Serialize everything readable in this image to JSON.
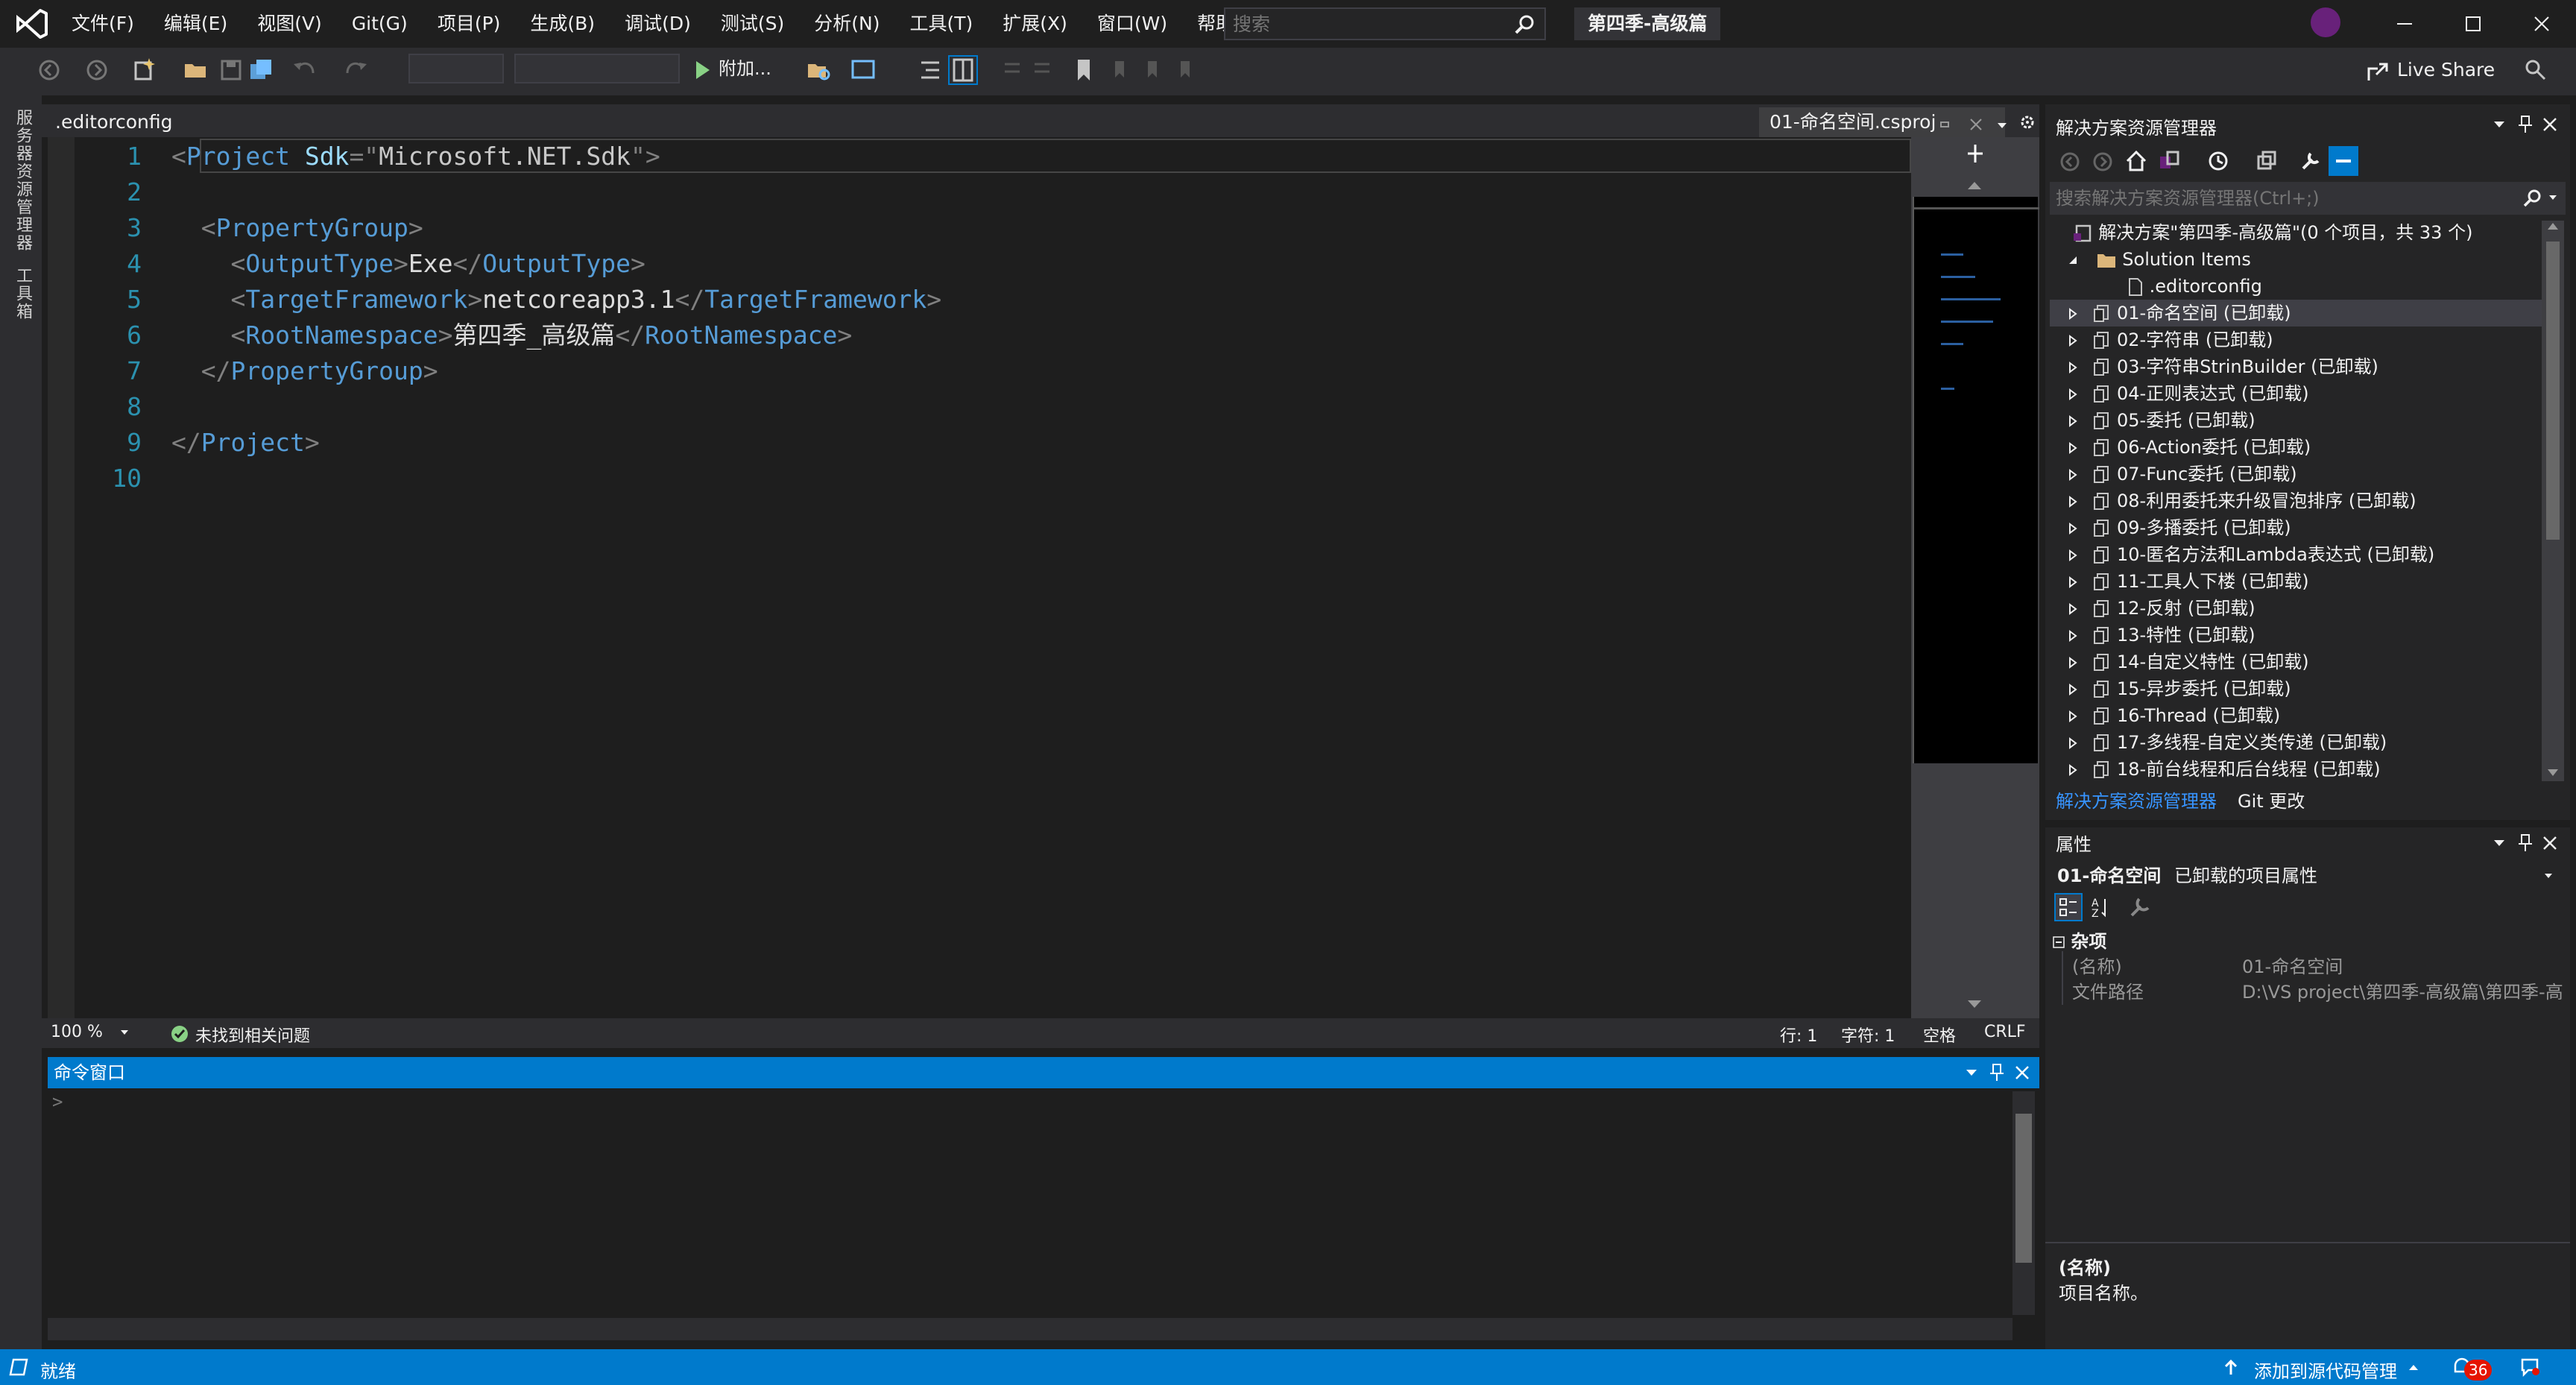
{
  "menu": [
    "文件(F)",
    "编辑(E)",
    "视图(V)",
    "Git(G)",
    "项目(P)",
    "生成(B)",
    "调试(D)",
    "测试(S)",
    "分析(N)",
    "工具(T)",
    "扩展(X)",
    "窗口(W)",
    "帮助(H)"
  ],
  "search": {
    "placeholder": "搜索"
  },
  "solution_name": "第四季-高级篇",
  "toolbar": {
    "attach_label": "附加...",
    "live_share": "Live Share"
  },
  "left_rail": {
    "server_explorer": "服务器资源管理器",
    "toolbox": "工具箱"
  },
  "editor_tabs": {
    "left_file": ".editorconfig",
    "active_file": "01-命名空间.csproj"
  },
  "code": {
    "line_numbers": [
      "1",
      "2",
      "3",
      "4",
      "5",
      "6",
      "7",
      "8",
      "9",
      "10"
    ],
    "l1": {
      "open": "<",
      "tag": "Project",
      "attr": " Sdk",
      "eq": "=\"",
      "val": "Microsoft.NET.Sdk",
      "close": "\">"
    },
    "l3": {
      "open": "<",
      "tag": "PropertyGroup",
      "close": ">"
    },
    "l4": {
      "tag": "OutputType",
      "text": "Exe"
    },
    "l5": {
      "tag": "TargetFramework",
      "text": "netcoreapp3.1"
    },
    "l6": {
      "tag": "RootNamespace",
      "text": "第四季_高级篇"
    },
    "l7": {
      "tag": "PropertyGroup"
    },
    "l9": {
      "tag": "Project"
    }
  },
  "editor_status": {
    "zoom": "100 %",
    "issues": "未找到相关问题",
    "line": "行: 1",
    "col": "字符: 1",
    "spaces": "空格",
    "eol": "CRLF"
  },
  "command_window": {
    "title": "命令窗口",
    "prompt": ">"
  },
  "solution_explorer": {
    "title": "解决方案资源管理器",
    "search_placeholder": "搜索解决方案资源管理器(Ctrl+;)",
    "root": "解决方案\"第四季-高级篇\"(0 个项目，共 33 个)",
    "solution_items": "Solution Items",
    "editorconfig": ".editorconfig",
    "projects": [
      "01-命名空间 (已卸载)",
      "02-字符串 (已卸载)",
      "03-字符串StrinBuilder (已卸载)",
      "04-正则表达式 (已卸载)",
      "05-委托 (已卸载)",
      "06-Action委托 (已卸载)",
      "07-Func委托 (已卸载)",
      "08-利用委托来升级冒泡排序 (已卸载)",
      "09-多播委托 (已卸载)",
      "10-匿名方法和Lambda表达式 (已卸载)",
      "11-工具人下楼 (已卸载)",
      "12-反射 (已卸载)",
      "13-特性 (已卸载)",
      "14-自定义特性 (已卸载)",
      "15-异步委托 (已卸载)",
      "16-Thread (已卸载)",
      "17-多线程-自定义类传递 (已卸载)",
      "18-前台线程和后台线程 (已卸载)"
    ],
    "tab_se": "解决方案资源管理器",
    "tab_git": "Git 更改"
  },
  "properties": {
    "title": "属性",
    "object_name": "01-命名空间",
    "object_type": "已卸载的项目属性",
    "category": "杂项",
    "rows": [
      {
        "key": "(名称)",
        "value": "01-命名空间"
      },
      {
        "key": "文件路径",
        "value": "D:\\VS project\\第四季-高级篇\\第四季-高"
      }
    ],
    "desc_title": "(名称)",
    "desc_text": "项目名称。"
  },
  "statusbar": {
    "ready": "就绪",
    "add_source": "添加到源代码管理",
    "notifications": "36"
  },
  "colors": {
    "accent": "#007acc",
    "tag": "#569cd6",
    "attr": "#9cdcfe",
    "line_number": "#2b91af",
    "vs_purple": "#68217a"
  }
}
